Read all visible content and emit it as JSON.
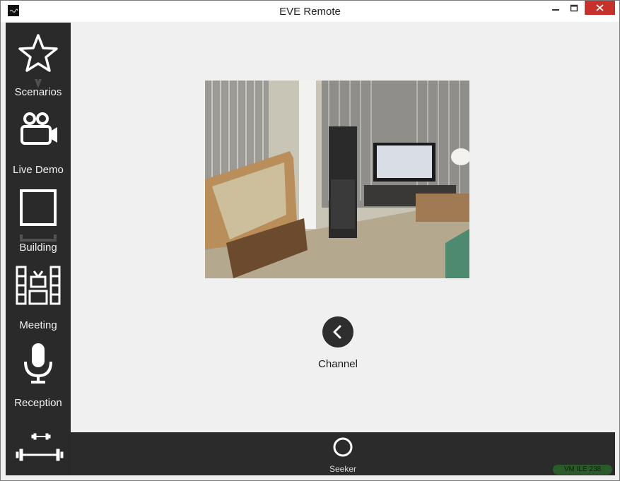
{
  "window": {
    "title": "EVE Remote",
    "controls": [
      "minimize-icon",
      "maximize-icon",
      "close-icon"
    ]
  },
  "sidebar": {
    "items": [
      {
        "label": "Scenarios",
        "icon": "star-icon"
      },
      {
        "label": "Live Demo",
        "icon": "video-camera-icon"
      },
      {
        "label": "Building",
        "icon": "building-square-icon"
      },
      {
        "label": "Meeting",
        "icon": "meeting-room-icon"
      },
      {
        "label": "Reception",
        "icon": "microphone-icon"
      },
      {
        "label": "",
        "icon": "dumbbell-icon"
      }
    ]
  },
  "main": {
    "video": {
      "icon": "camera-feed-image"
    },
    "channel": {
      "label": "Channel",
      "icon": "chevron-left-icon"
    }
  },
  "bottombar": {
    "seeker_label": "Seeker",
    "status_badge": "VM ILE 238"
  },
  "colors": {
    "sidebar_bg": "#2a2a2a",
    "content_bg": "#f0f0f0",
    "close_button": "#c7312b",
    "status_badge": "#2b5a2b"
  }
}
